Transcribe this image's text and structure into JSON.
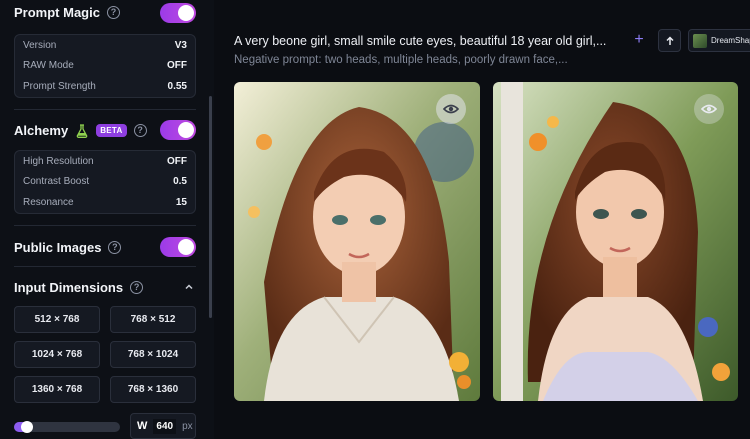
{
  "sidebar": {
    "prompt_magic": {
      "title": "Prompt Magic",
      "help": "?",
      "enabled": true,
      "rows": [
        {
          "label": "Version",
          "value": "V3"
        },
        {
          "label": "RAW Mode",
          "value": "OFF"
        },
        {
          "label": "Prompt Strength",
          "value": "0.55"
        }
      ]
    },
    "alchemy": {
      "title": "Alchemy",
      "badge": "BETA",
      "help": "?",
      "enabled": true,
      "rows": [
        {
          "label": "High Resolution",
          "value": "OFF"
        },
        {
          "label": "Contrast Boost",
          "value": "0.5"
        },
        {
          "label": "Resonance",
          "value": "15"
        }
      ]
    },
    "public_images": {
      "title": "Public Images",
      "help": "?",
      "enabled": true
    },
    "input_dimensions": {
      "title": "Input Dimensions",
      "help": "?",
      "options": [
        "512 × 768",
        "768 × 512",
        "1024 × 768",
        "768 × 1024",
        "1360 × 768",
        "768 × 1360"
      ]
    },
    "width": {
      "label": "W",
      "value": "640",
      "unit": "px",
      "slider_fraction": 0.12
    }
  },
  "main": {
    "prompt": "A very beone girl, small smile cute eyes, beautiful 18 year old girl,...",
    "negative_prompt": "Negative prompt: two heads, multiple heads, poorly drawn face,...",
    "add_symbol": "+",
    "model_name": "DreamShaper"
  },
  "colors": {
    "accent": "#c04ae0",
    "beta_badge": "#8e3ee0",
    "background": "#0b0d12"
  }
}
